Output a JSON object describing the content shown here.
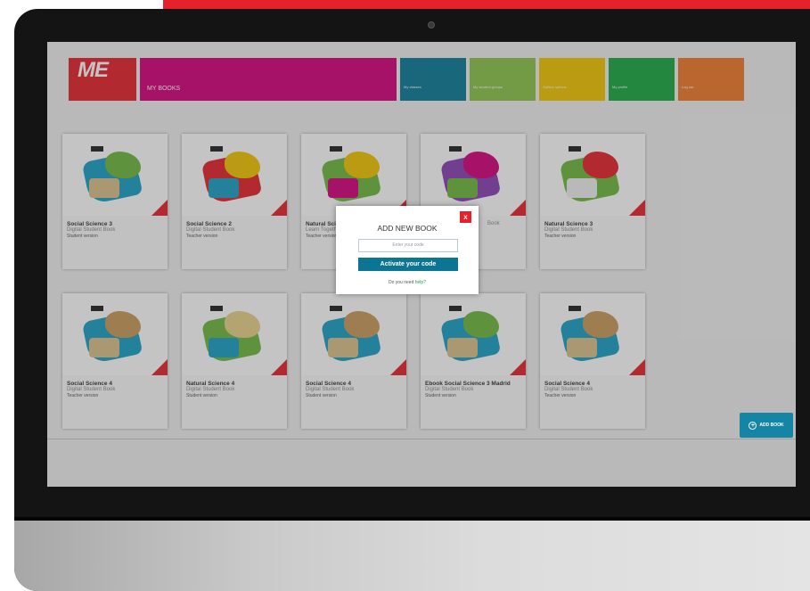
{
  "header": {
    "logo": "ME",
    "my_books": "MY BOOKS",
    "tiles": [
      {
        "label": "My classes"
      },
      {
        "label": "My student groups"
      },
      {
        "label": "Gallery options"
      },
      {
        "label": "My profile"
      },
      {
        "label": "Log out"
      }
    ]
  },
  "books": [
    {
      "title": "Social Science 3",
      "subtitle": "Digital Student Book",
      "version": "Student version"
    },
    {
      "title": "Social Science 2",
      "subtitle": "Digital Student Book",
      "version": "Teacher version"
    },
    {
      "title": "Natural Science 3",
      "subtitle": "Learn Together",
      "version": "Teacher version"
    },
    {
      "title": "",
      "subtitle": "Book",
      "version": ""
    },
    {
      "title": "Natural Science 3",
      "subtitle": "Digital Student Book",
      "version": "Teacher version"
    },
    {
      "title": "Social Science 4",
      "subtitle": "Digital Student Book",
      "version": "Teacher version"
    },
    {
      "title": "Natural Science 4",
      "subtitle": "Digital Student Book",
      "version": "Student version"
    },
    {
      "title": "Social Science 4",
      "subtitle": "Digital Student Book",
      "version": "Student version"
    },
    {
      "title": "Ebook Social Science 3 Madrid",
      "subtitle": "Digital Student Book",
      "version": "Student version"
    },
    {
      "title": "Social Science 4",
      "subtitle": "Digital Student Book",
      "version": "Teacher version"
    }
  ],
  "add_book": {
    "label": "ADD BOOK"
  },
  "modal": {
    "title": "ADD NEW BOOK",
    "close": "x",
    "placeholder": "Enter your code",
    "button": "Activate your code",
    "help_prefix": "Do you need ",
    "help_link": "help?"
  },
  "colors": {
    "accent_red": "#e5222b",
    "magenta": "#d4007a",
    "teal": "#0c7594"
  }
}
